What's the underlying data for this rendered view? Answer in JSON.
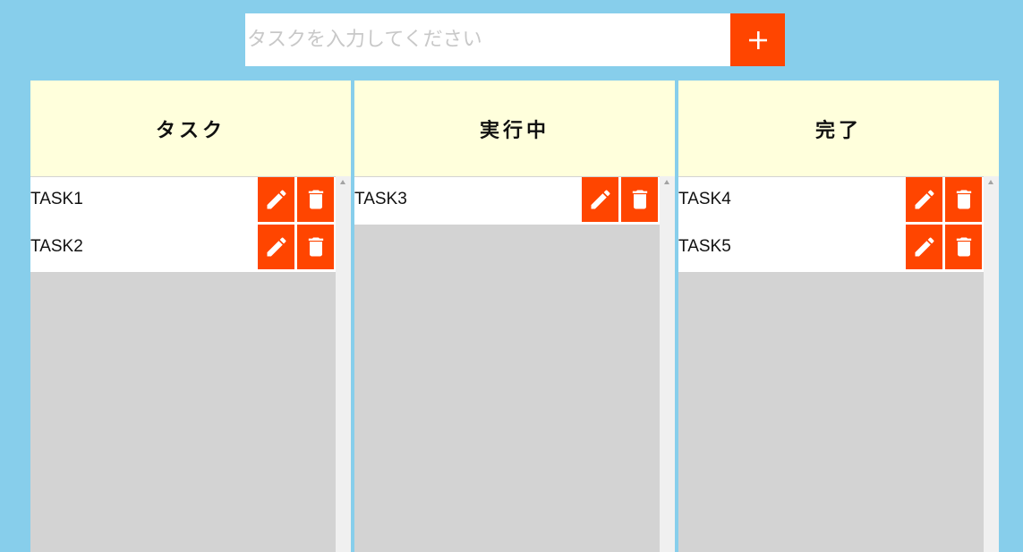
{
  "input": {
    "placeholder": "タスクを入力してください",
    "add_icon": "plus-icon"
  },
  "columns": [
    {
      "title": "タスク",
      "tasks": [
        {
          "name": "TASK1"
        },
        {
          "name": "TASK2"
        }
      ]
    },
    {
      "title": "実行中",
      "tasks": [
        {
          "name": "TASK3"
        }
      ]
    },
    {
      "title": "完了",
      "tasks": [
        {
          "name": "TASK4"
        },
        {
          "name": "TASK5"
        }
      ]
    }
  ],
  "icons": {
    "edit": "pencil-icon",
    "delete": "trash-icon"
  },
  "colors": {
    "background": "#87ceeb",
    "accent": "#ff4500",
    "header": "#ffffdc",
    "list_background": "#d3d3d3"
  }
}
